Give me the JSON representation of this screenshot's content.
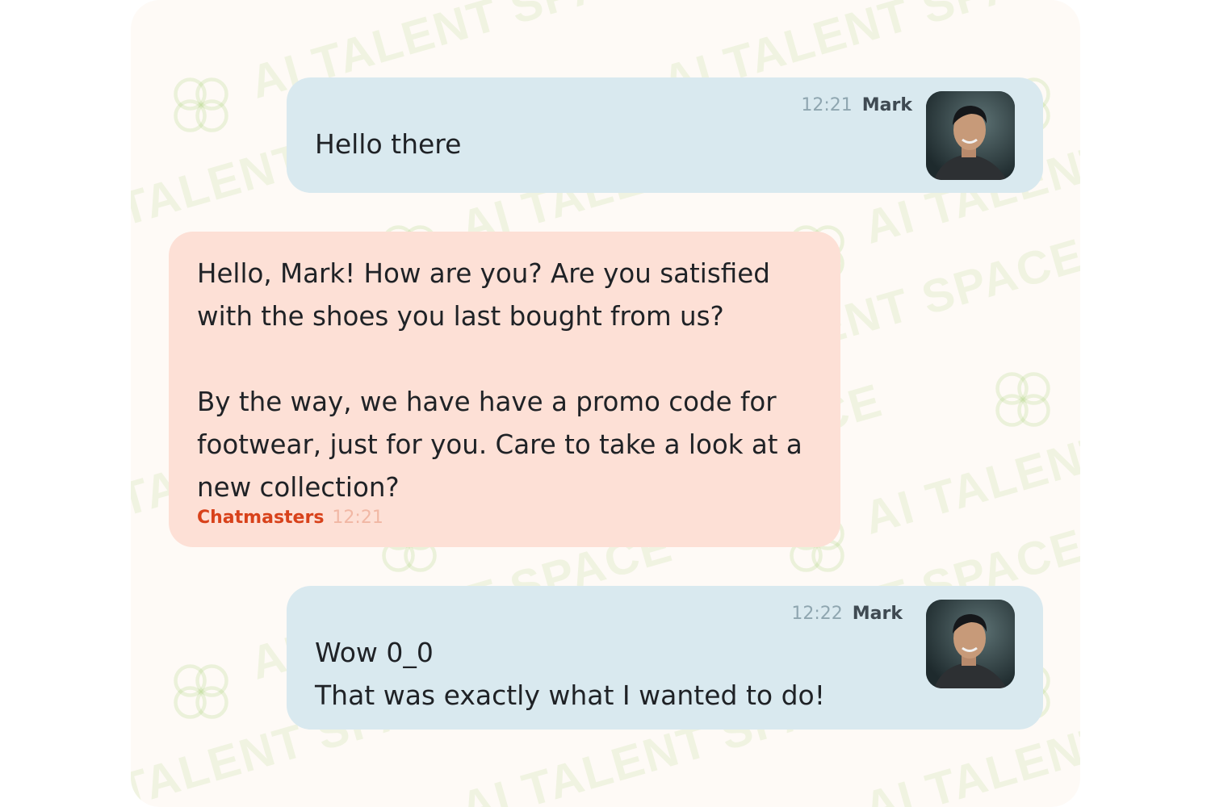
{
  "watermark": {
    "text": "AI TALENT SPACE"
  },
  "messages": [
    {
      "sender": "user",
      "author": "Mark",
      "time": "12:21",
      "text": "Hello there"
    },
    {
      "sender": "bot",
      "author": "Chatmasters",
      "time": "12:21",
      "text": "Hello, Mark! How are you? Are you satisfied with the shoes you last bought from us?\n\nBy the way, we have have a promo code for footwear, just for you. Care to take a look at a new collection?"
    },
    {
      "sender": "user",
      "author": "Mark",
      "time": "12:22",
      "text": "Wow 0_0\nThat was exactly what I wanted to do!"
    }
  ],
  "icons": {
    "avatar": "user-photo-avatar"
  },
  "colors": {
    "user_bubble": "#d9e9ef",
    "bot_bubble": "#fde0d6",
    "bot_author": "#d8421b",
    "panel_background": "#fefaf6"
  }
}
